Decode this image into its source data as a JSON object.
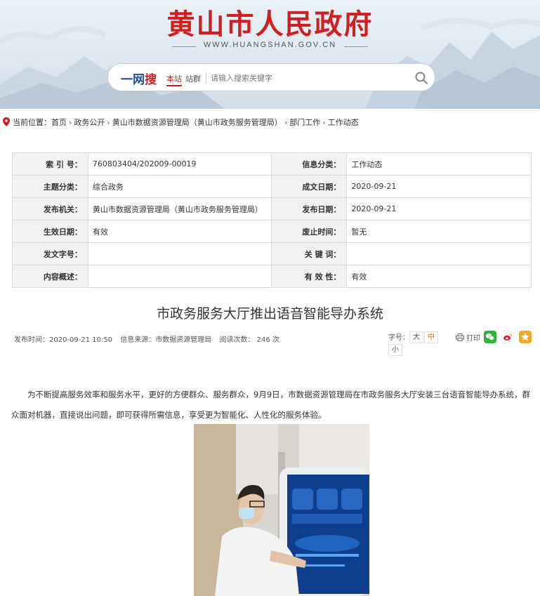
{
  "header": {
    "site_title": "黄山市人民政府",
    "site_url": "WWW.HUANGSHAN.GOV.CN",
    "search": {
      "logo_part1": "一网",
      "logo_part2": "搜",
      "scope_this": "本站",
      "scope_group": "站群",
      "placeholder": "请输入搜索关键字"
    }
  },
  "breadcrumb": {
    "prefix": "当前位置：",
    "items": [
      "首页",
      "政务公开",
      "黄山市数据资源管理局（黄山市政务服务管理局）",
      "部门工作",
      "工作动态"
    ]
  },
  "meta_table": {
    "rows": [
      {
        "l1": "索  引  号：",
        "v1": "760803404/202009-00019",
        "l2": "信息分类：",
        "v2": "工作动态"
      },
      {
        "l1": "主题分类：",
        "v1": "综合政务",
        "l2": "成文日期：",
        "v2": "2020-09-21"
      },
      {
        "l1": "发布机关：",
        "v1": "黄山市数据资源管理局（黄山市政务服务管理局）",
        "l2": "发布日期：",
        "v2": "2020-09-21"
      },
      {
        "l1": "生效日期：",
        "v1": "有效",
        "l2": "废止时间：",
        "v2": "暂无"
      },
      {
        "l1": "发文字号：",
        "v1": "",
        "l2": "关  键  词：",
        "v2": ""
      },
      {
        "l1": "内容概述：",
        "v1": "",
        "l2": "有  效  性：",
        "v2": "有效"
      }
    ]
  },
  "article": {
    "title": "市政务服务大厅推出语音智能导办系统",
    "publish_time": "发布时间：2020-09-21 10:50",
    "source": "信息来源：市数据资源管理局",
    "views": "阅读次数： 246 次",
    "font_size_label": "字号：",
    "font_big": "大",
    "font_mid": "中",
    "font_small": "小",
    "print_label": "打印",
    "body": "为不断提高服务效率和服务水平，更好的方便群众、服务群众，9月9日，市数据资源管理局在市政务服务大厅安装三台语音智能导办系统，群众面对机器，直接说出问题，即可获得所需信息，享受更为智能化、人性化的服务体验。"
  },
  "colors": {
    "brand_red": "#d11f1f",
    "brand_blue": "#1d4f9c",
    "accent_orange": "#e06a00"
  }
}
